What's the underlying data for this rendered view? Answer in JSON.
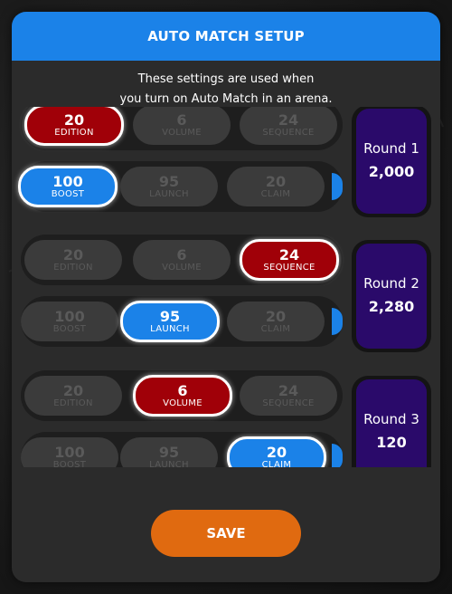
{
  "modal": {
    "title": "AUTO MATCH SETUP",
    "subtitle_line1": "These settings are used when",
    "subtitle_line2": "you turn on Auto Match in an arena.",
    "save_label": "SAVE"
  },
  "rounds": [
    {
      "name": "Round 1",
      "score": "2,000",
      "row1": [
        {
          "num": "20",
          "label": "EDITION",
          "selected": true
        },
        {
          "num": "6",
          "label": "VOLUME",
          "selected": false
        },
        {
          "num": "24",
          "label": "SEQUENCE",
          "selected": false
        }
      ],
      "row2": [
        {
          "num": "100",
          "label": "BOOST",
          "selected": true
        },
        {
          "num": "95",
          "label": "LAUNCH",
          "selected": false
        },
        {
          "num": "20",
          "label": "CLAIM",
          "selected": false
        }
      ]
    },
    {
      "name": "Round 2",
      "score": "2,280",
      "row1": [
        {
          "num": "20",
          "label": "EDITION",
          "selected": false
        },
        {
          "num": "6",
          "label": "VOLUME",
          "selected": false
        },
        {
          "num": "24",
          "label": "SEQUENCE",
          "selected": true
        }
      ],
      "row2": [
        {
          "num": "100",
          "label": "BOOST",
          "selected": false
        },
        {
          "num": "95",
          "label": "LAUNCH",
          "selected": true
        },
        {
          "num": "20",
          "label": "CLAIM",
          "selected": false
        }
      ]
    },
    {
      "name": "Round 3",
      "score": "120",
      "row1": [
        {
          "num": "20",
          "label": "EDITION",
          "selected": false
        },
        {
          "num": "6",
          "label": "VOLUME",
          "selected": true
        },
        {
          "num": "24",
          "label": "SEQUENCE",
          "selected": false
        }
      ],
      "row2": [
        {
          "num": "100",
          "label": "BOOST",
          "selected": false
        },
        {
          "num": "95",
          "label": "LAUNCH",
          "selected": false
        },
        {
          "num": "20",
          "label": "CLAIM",
          "selected": true
        }
      ]
    }
  ],
  "colors": {
    "header_blue": "#1b82e8",
    "select_red": "#a00008",
    "round_purple": "#2a0a6a",
    "save_orange": "#e06a10"
  }
}
